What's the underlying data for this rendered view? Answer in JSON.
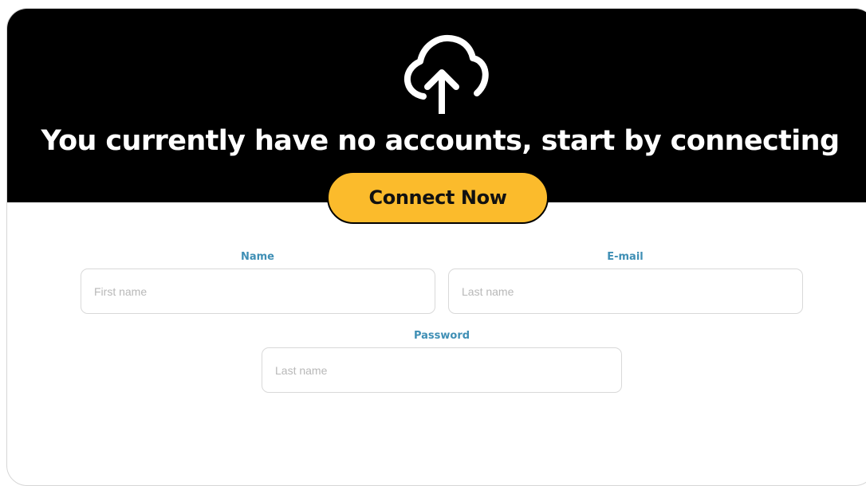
{
  "hero": {
    "icon": "cloud-upload-icon",
    "headline": "You currently have no accounts, start by connecting",
    "connect_label": "Connect Now"
  },
  "form": {
    "name": {
      "label": "Name",
      "placeholder": "First name",
      "value": ""
    },
    "email": {
      "label": "E-mail",
      "placeholder": "Last name",
      "value": ""
    },
    "password": {
      "label": "Password",
      "placeholder": "Last name",
      "value": ""
    }
  },
  "colors": {
    "hero_background": "#000000",
    "button_background": "#fbbb2c",
    "label_color": "#3f8fb5",
    "field_border": "#d9d9d9"
  }
}
